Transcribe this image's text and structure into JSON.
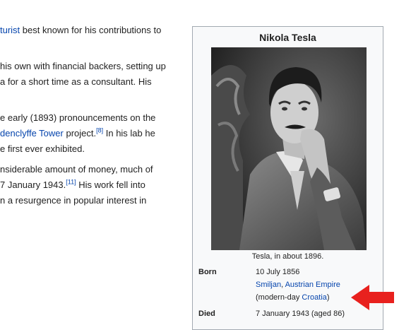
{
  "article": {
    "p1": {
      "link": "turist",
      "text": " best known for his contributions to"
    },
    "p2_line1": "his own with financial backers, setting up",
    "p2_line2": "a for a short time as a consultant. His",
    "p3_line1": "e early (1893) pronouncements on the",
    "p3_line2": {
      "link": "denclyffe Tower",
      "text": " project.",
      "ref": "[8]",
      "tail": " In his lab he"
    },
    "p3_line3": "e first ever exhibited.",
    "p4_line1": "nsiderable amount of money, much of",
    "p4_line2": {
      "text": "7 January 1943.",
      "ref": "[11]",
      "tail": " His work fell into"
    },
    "p4_line3": "n a resurgence in popular interest in"
  },
  "infobox": {
    "title": "Nikola Tesla",
    "image_caption": "Tesla, in about 1896.",
    "born_label": "Born",
    "born_date": "10 July 1856",
    "born_place_link1": "Smiljan",
    "born_place_sep": ", ",
    "born_place_link2": "Austrian Empire",
    "born_modern_open": "(modern-day ",
    "born_modern_link": "Croatia",
    "born_modern_close": ")",
    "died_label": "Died",
    "died_value": "7 January 1943 (aged 86)"
  },
  "colors": {
    "link": "#0645ad",
    "arrow": "#e8211e",
    "infobox_bg": "#f8f9fa",
    "infobox_border": "#a2a9b1"
  }
}
